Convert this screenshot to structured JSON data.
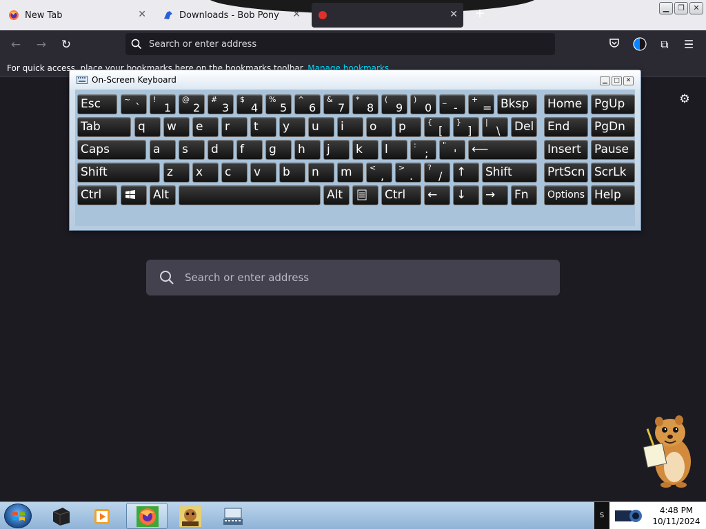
{
  "browser": {
    "tabs": [
      {
        "title": "New Tab",
        "favicon": "firefox-icon"
      },
      {
        "title": "Downloads - Bob Pony",
        "favicon": "bob-pony-icon"
      },
      {
        "title": "",
        "favicon": "red-site-icon",
        "active": true
      }
    ],
    "new_tab_symbol": "+",
    "address_placeholder": "Search or enter address",
    "bookmarks_text": "For quick access, place your bookmarks here on the bookmarks toolbar.",
    "bookmarks_link": "Manage bookmarks…",
    "content_search_placeholder": "Search or enter address"
  },
  "osk": {
    "title": "On-Screen Keyboard",
    "rows": [
      [
        {
          "label": "Esc"
        },
        {
          "top": "~",
          "bot": "`"
        },
        {
          "top": "!",
          "bot": "1"
        },
        {
          "top": "@",
          "bot": "2"
        },
        {
          "top": "#",
          "bot": "3"
        },
        {
          "top": "$",
          "bot": "4"
        },
        {
          "top": "%",
          "bot": "5"
        },
        {
          "top": "^",
          "bot": "6"
        },
        {
          "top": "&",
          "bot": "7"
        },
        {
          "top": "*",
          "bot": "8"
        },
        {
          "top": "(",
          "bot": "9"
        },
        {
          "top": ")",
          "bot": "0"
        },
        {
          "top": "_",
          "bot": "-"
        },
        {
          "top": "+",
          "bot": "="
        },
        {
          "label": "Bksp"
        },
        {
          "label": "Home"
        },
        {
          "label": "PgUp"
        }
      ],
      [
        {
          "label": "Tab"
        },
        {
          "label": "q"
        },
        {
          "label": "w"
        },
        {
          "label": "e"
        },
        {
          "label": "r"
        },
        {
          "label": "t"
        },
        {
          "label": "y"
        },
        {
          "label": "u"
        },
        {
          "label": "i"
        },
        {
          "label": "o"
        },
        {
          "label": "p"
        },
        {
          "top": "{",
          "bot": "["
        },
        {
          "top": "}",
          "bot": "]"
        },
        {
          "top": "|",
          "bot": "\\"
        },
        {
          "label": "Del"
        },
        {
          "label": "End"
        },
        {
          "label": "PgDn"
        }
      ],
      [
        {
          "label": "Caps"
        },
        {
          "label": "a"
        },
        {
          "label": "s"
        },
        {
          "label": "d"
        },
        {
          "label": "f"
        },
        {
          "label": "g"
        },
        {
          "label": "h"
        },
        {
          "label": "j"
        },
        {
          "label": "k"
        },
        {
          "label": "l"
        },
        {
          "top": ":",
          "bot": ";"
        },
        {
          "top": "\"",
          "bot": "'"
        },
        {
          "label": "⟵"
        },
        {
          "label": "Insert"
        },
        {
          "label": "Pause"
        }
      ],
      [
        {
          "label": "Shift"
        },
        {
          "label": "z"
        },
        {
          "label": "x"
        },
        {
          "label": "c"
        },
        {
          "label": "v"
        },
        {
          "label": "b"
        },
        {
          "label": "n"
        },
        {
          "label": "m"
        },
        {
          "top": "<",
          "bot": ","
        },
        {
          "top": ">",
          "bot": "."
        },
        {
          "top": "?",
          "bot": "/"
        },
        {
          "label": "↑"
        },
        {
          "label": "Shift"
        },
        {
          "label": "PrtScn"
        },
        {
          "label": "ScrLk"
        }
      ],
      [
        {
          "label": "Ctrl"
        },
        {
          "label": "",
          "icon": "windows-logo-icon"
        },
        {
          "label": "Alt"
        },
        {
          "label": ""
        },
        {
          "label": "Alt"
        },
        {
          "label": "",
          "icon": "menu-key-icon"
        },
        {
          "label": "Ctrl"
        },
        {
          "label": "←"
        },
        {
          "label": "↓"
        },
        {
          "label": "→"
        },
        {
          "label": "Fn"
        },
        {
          "label": "Options"
        },
        {
          "label": "Help"
        }
      ]
    ]
  },
  "taskbar": {
    "items": [
      {
        "name": "terminal-icon"
      },
      {
        "name": "media-player-icon"
      },
      {
        "name": "firefox-icon",
        "active": true
      },
      {
        "name": "bonzi-hamster-icon"
      },
      {
        "name": "on-screen-keyboard-icon"
      }
    ],
    "tray_label": "S",
    "time": "4:48 PM",
    "date": "10/11/2024"
  },
  "colors": {
    "tab_strip": "#ebebef",
    "toolbar": "#2b2a33",
    "page_bg": "#1c1b22",
    "accent_link": "#00ddff",
    "key_bg": "#1a1a1a",
    "osk_frame": "#a8c3da"
  }
}
